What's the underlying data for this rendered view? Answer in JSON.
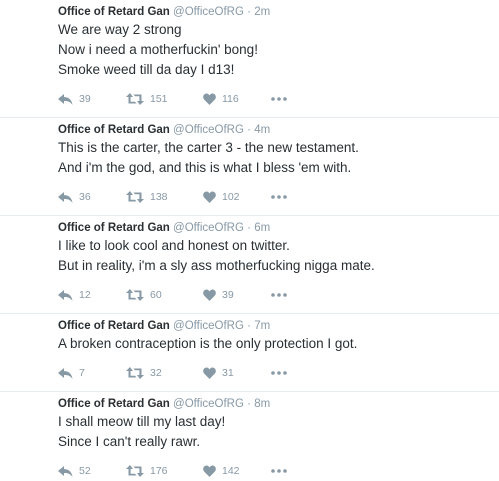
{
  "tweets": [
    {
      "name": "Office of Retard Gan",
      "handle": "@OfficeOfRG",
      "time": "2m",
      "lines": [
        "We are way 2 strong",
        "Now i need a motherfuckin' bong!",
        "Smoke weed till da day I d13!"
      ],
      "replies": "39",
      "retweets": "151",
      "likes": "116"
    },
    {
      "name": "Office of Retard Gan",
      "handle": "@OfficeOfRG",
      "time": "4m",
      "lines": [
        "This is the carter, the carter 3 - the new testament.",
        "And i'm the god, and this is what I bless 'em with."
      ],
      "replies": "36",
      "retweets": "138",
      "likes": "102"
    },
    {
      "name": "Office of Retard Gan",
      "handle": "@OfficeOfRG",
      "time": "6m",
      "lines": [
        "I like to look cool and honest on twitter.",
        "But in reality, i'm a sly ass motherfucking nigga mate."
      ],
      "replies": "12",
      "retweets": "60",
      "likes": "39"
    },
    {
      "name": "Office of Retard Gan",
      "handle": "@OfficeOfRG",
      "time": "7m",
      "lines": [
        "A broken contraception is the only protection I got."
      ],
      "replies": "7",
      "retweets": "32",
      "likes": "31"
    },
    {
      "name": "Office of Retard Gan",
      "handle": "@OfficeOfRG",
      "time": "8m",
      "lines": [
        "I shall meow till my last day!",
        "Since I can't really rawr."
      ],
      "replies": "52",
      "retweets": "176",
      "likes": "142"
    }
  ],
  "separator": "·",
  "icons": {
    "reply": "reply-icon",
    "retweet": "retweet-icon",
    "like": "heart-icon",
    "more": "more-icon"
  },
  "colors": {
    "name": "#292f33",
    "meta": "#8899a6",
    "divider": "#e6ecf0"
  }
}
